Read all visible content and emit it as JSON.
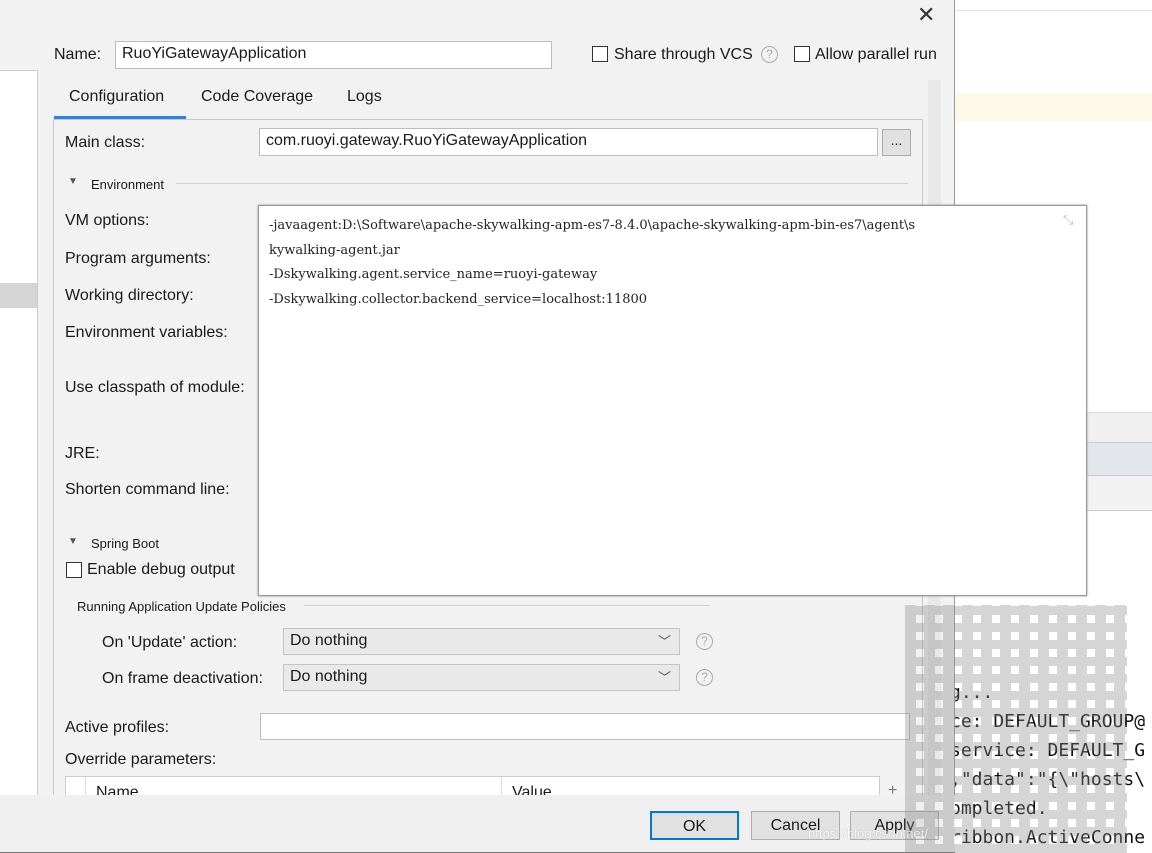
{
  "dialog": {
    "name_label": "Name:",
    "name_value": "RuoYiGatewayApplication",
    "share_vcs": "Share through VCS",
    "allow_parallel": "Allow parallel run",
    "tabs": [
      {
        "label": "Configuration",
        "active": true
      },
      {
        "label": "Code Coverage"
      },
      {
        "label": "Logs"
      }
    ],
    "main_class_label": "Main class:",
    "main_class_value": "com.ruoyi.gateway.RuoYiGatewayApplication",
    "browse": "...",
    "environment_section": "Environment",
    "vm_options_label": "VM options:",
    "program_args_label": "Program arguments:",
    "working_dir_label": "Working directory:",
    "env_vars_label": "Environment variables:",
    "classpath_label": "Use classpath of module:",
    "jre_label": "JRE:",
    "shorten_label": "Shorten command line:",
    "spring_boot_section": "Spring Boot",
    "debug_output": "Enable debug output",
    "update_policies": "Running Application Update Policies",
    "on_update_label": "On 'Update' action:",
    "on_update_value": "Do nothing",
    "on_frame_label": "On frame deactivation:",
    "on_frame_value": "Do nothing",
    "active_profiles_label": "Active profiles:",
    "override_label": "Override parameters:",
    "table_columns": [
      "Name",
      "Value"
    ],
    "ok": "OK",
    "cancel": "Cancel",
    "apply": "Apply"
  },
  "vm_popup": {
    "lines": [
      "-javaagent:D:\\Software\\apache-skywalking-apm-es7-8.4.0\\apache-skywalking-apm-bin-es7\\agent\\s",
      "kywalking-agent.jar",
      "-Dskywalking.agent.service_name=ruoyi-gateway",
      "-Dskywalking.collector.backend_service=localhost:11800"
    ]
  },
  "console": {
    "lines": [
      "rServle",
      "g...",
      "ce: DEFAULT_GROUP@",
      "service: DEFAULT_G",
      ",\"data\":\"{\\\"hosts\\",
      "ompleted.",
      "ribbon.ActiveConne"
    ]
  },
  "watermark": "https://blog.csdn.net/"
}
